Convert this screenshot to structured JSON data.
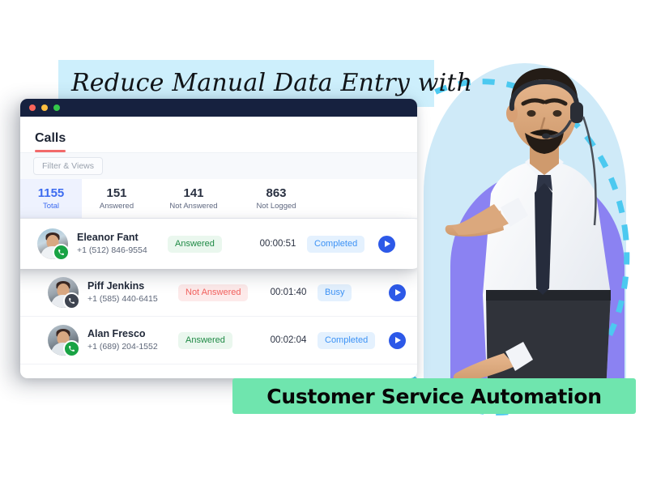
{
  "headline": {
    "top_text": "Reduce Manual Data Entry with",
    "bottom_text": "Customer Service Automation"
  },
  "colors": {
    "band_blue": "#cdeffc",
    "arch_blue": "#cfeaf8",
    "purple": "#8b82f2",
    "banner_green": "#6fe5ae",
    "titlebar_navy": "#16213f",
    "accent_blue": "#3c6bf0",
    "play_blue": "#2d59e8",
    "tab_underline": "#f26a6a",
    "answered_green": "#1f8a45",
    "not_answered_red": "#f2615e",
    "dashed_cyan": "#4cc9f0"
  },
  "window": {
    "traffic_lights": [
      "close-red",
      "minimize-yellow",
      "maximize-green"
    ],
    "tab_label": "Calls",
    "filter_button": "Filter & Views",
    "stats": [
      {
        "value": "1155",
        "label": "Total",
        "highlighted": true
      },
      {
        "value": "151",
        "label": "Answered",
        "highlighted": false
      },
      {
        "value": "141",
        "label": "Not Answered",
        "highlighted": false
      },
      {
        "value": "863",
        "label": "Not Logged",
        "highlighted": false
      }
    ],
    "calls": [
      {
        "name": "Eleanor Fant",
        "phone": "+1 (512) 846-9554",
        "status": "Answered",
        "status_kind": "answered",
        "duration": "00:00:51",
        "result": "Completed",
        "result_kind": "completed",
        "badge_kind": "green",
        "play_icon": "play-icon"
      },
      {
        "name": "Piff Jenkins",
        "phone": "+1 (585) 440-6415",
        "status": "Not Answered",
        "status_kind": "notanswered",
        "duration": "00:01:40",
        "result": "Busy",
        "result_kind": "busy",
        "badge_kind": "dark",
        "play_icon": "play-icon"
      },
      {
        "name": "Alan Fresco",
        "phone": "+1 (689) 204-1552",
        "status": "Answered",
        "status_kind": "answered",
        "duration": "00:02:04",
        "result": "Completed",
        "result_kind": "completed",
        "badge_kind": "green",
        "play_icon": "play-icon"
      }
    ]
  },
  "photo": {
    "alt": "call-center-agent-with-headset-pointing-left"
  }
}
